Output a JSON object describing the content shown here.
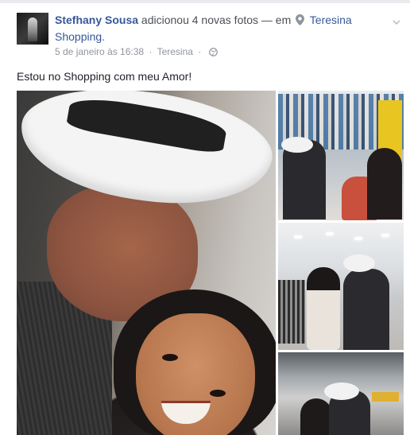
{
  "post": {
    "author": "Stefhany Sousa",
    "action": "adicionou 4 novas fotos — em",
    "location": "Teresina Shopping.",
    "timestamp": "5 de janeiro às 16:38",
    "separator": "·",
    "place": "Teresina",
    "privacy_icon": "globe-icon",
    "status_text": "Estou no Shopping com meu Amor!",
    "photo_count": 4
  },
  "icons": {
    "location": "map-pin-icon",
    "menu": "chevron-down-icon"
  },
  "colors": {
    "link": "#365899",
    "meta": "#90949c",
    "text": "#1d2129"
  }
}
